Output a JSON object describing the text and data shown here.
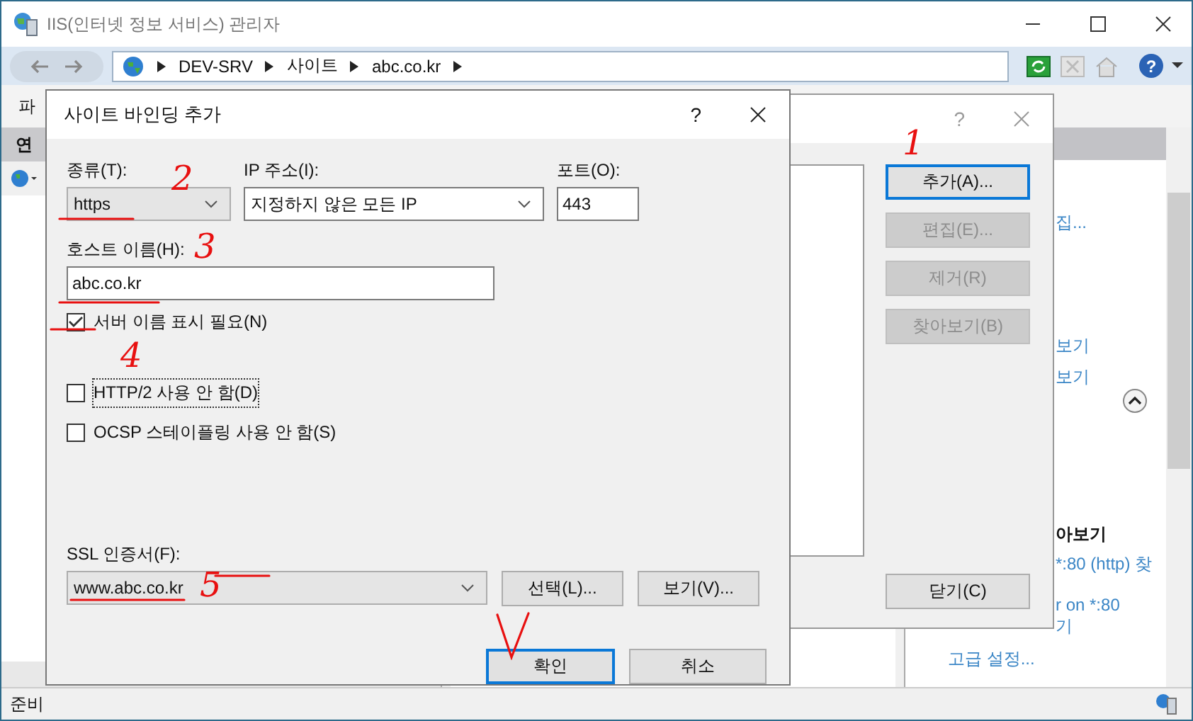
{
  "window": {
    "title": "IIS(인터넷 정보 서비스) 관리자"
  },
  "address_bar": {
    "breadcrumb": [
      "DEV-SRV",
      "사이트",
      "abc.co.kr"
    ]
  },
  "menu_bar": {
    "items": [
      "파"
    ]
  },
  "connections_panel": {
    "title": "연"
  },
  "toolbar": {
    "help": "?"
  },
  "actions_panel": {
    "items": [
      {
        "kind": "link",
        "label": "집..."
      },
      {
        "kind": "link",
        "label": "보기"
      },
      {
        "kind": "link",
        "label": "보기"
      },
      {
        "kind": "heading",
        "label": "아보기"
      },
      {
        "kind": "link",
        "label": "*:80 (http) 찾"
      },
      {
        "kind": "link",
        "label": "r on *:80"
      },
      {
        "kind": "link",
        "label": "기"
      },
      {
        "kind": "link",
        "label": "고급 설정..."
      }
    ]
  },
  "bindings_dialog": {
    "help": "?",
    "buttons": [
      {
        "label": "추가(A)...",
        "disabled": false,
        "focused": true
      },
      {
        "label": "편집(E)...",
        "disabled": true,
        "focused": false
      },
      {
        "label": "제거(R)",
        "disabled": true,
        "focused": false
      },
      {
        "label": "찾아보기(B)",
        "disabled": true,
        "focused": false
      }
    ],
    "close_button": "닫기(C)"
  },
  "add_binding_dialog": {
    "title": "사이트 바인딩 추가",
    "help": "?",
    "type": {
      "label": "종류(T):",
      "value": "https"
    },
    "ip_address": {
      "label": "IP 주소(I):",
      "value": "지정하지 않은 모든 IP"
    },
    "port": {
      "label": "포트(O):",
      "value": "443"
    },
    "host_name": {
      "label": "호스트 이름(H):",
      "value": "abc.co.kr"
    },
    "options": [
      {
        "label": "서버 이름 표시 필요(N)",
        "checked": true
      },
      {
        "label": "HTTP/2 사용 안 함(D)",
        "checked": false
      },
      {
        "label": "OCSP 스테이플링 사용 안 함(S)",
        "checked": false
      }
    ],
    "ssl_certificate": {
      "label": "SSL 인증서(F):",
      "value": "www.abc.co.kr"
    },
    "cert_buttons": [
      "선택(L)...",
      "보기(V)..."
    ],
    "buttons": [
      {
        "label": "확인",
        "focused": true
      },
      {
        "label": "취소",
        "focused": false
      }
    ]
  },
  "status_bar": {
    "text": "준비"
  },
  "annotations": [
    "1",
    "2",
    "3",
    "4",
    "5"
  ]
}
